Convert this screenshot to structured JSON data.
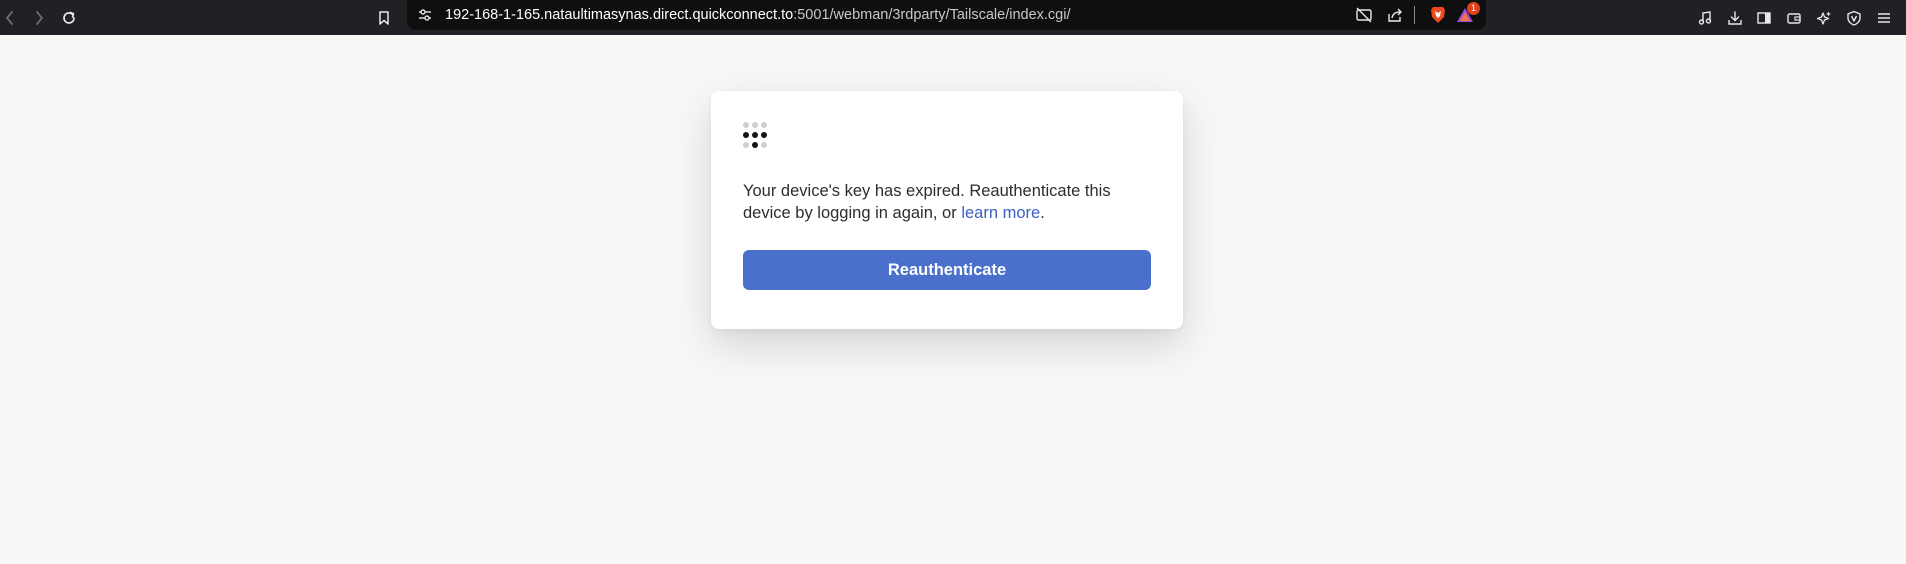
{
  "browser": {
    "url_host": "192-168-1-165.nataultimasynas.direct.quickconnect.to",
    "url_path": ":5001/webman/3rdparty/Tailscale/index.cgi/",
    "notification_count": "1",
    "toolbar_icons": [
      "back-icon",
      "forward-icon",
      "reload-icon",
      "bookmark-icon",
      "site-settings-icon",
      "camera-off-icon",
      "share-icon",
      "brave-shields-icon",
      "brave-rewards-icon",
      "media-icon",
      "downloads-icon",
      "sidebar-icon",
      "wallet-icon",
      "leo-ai-icon",
      "vpn-icon",
      "menu-icon"
    ]
  },
  "card": {
    "message_prefix": "Your device's key has expired. Reauthenticate this device by logging in again, or ",
    "link_text": "learn more",
    "message_suffix": ".",
    "button_label": "Reauthenticate"
  },
  "colors": {
    "page_background": "#f8f7f5",
    "toolbar": "#202124",
    "button": "#4b70cc",
    "link": "#3d5fc1",
    "badge": "#e3401a"
  }
}
